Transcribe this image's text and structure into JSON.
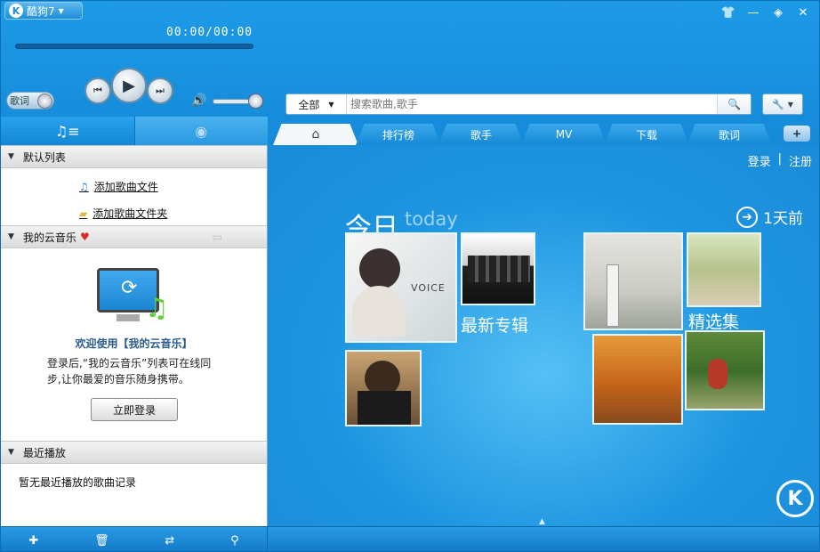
{
  "app": {
    "title": "酷狗7",
    "logo_letter": "K"
  },
  "player": {
    "time": "00:00/00:00",
    "lyric_toggle": "歌词"
  },
  "search": {
    "scope": "全部",
    "placeholder": "搜索歌曲,歌手"
  },
  "tabs": [
    {
      "label": "",
      "icon": "home-icon"
    },
    {
      "label": "排行榜"
    },
    {
      "label": "歌手"
    },
    {
      "label": "MV"
    },
    {
      "label": "下载"
    },
    {
      "label": "歌词"
    }
  ],
  "tab_add": "+",
  "sidebar": {
    "default_list": {
      "title": "默认列表",
      "add_file": "添加歌曲文件",
      "add_folder": "添加歌曲文件夹"
    },
    "cloud": {
      "title": "我的云音乐",
      "welcome_title": "欢迎使用【我的云音乐】",
      "welcome_desc": "登录后,“我的云音乐”列表可在线同步,让你最爱的音乐随身携带。",
      "login_button": "立即登录"
    },
    "recent": {
      "title": "最近播放",
      "empty": "暂无最近播放的歌曲记录"
    }
  },
  "main": {
    "login": "登录",
    "separator": "|",
    "register": "注册",
    "today": "今日",
    "today_en": "today",
    "prev_day": "1天前",
    "new_albums": "最新专辑",
    "featured": "精选集",
    "album_cover_text": "VOICE"
  },
  "colors": {
    "accent": "#1a8fd9",
    "panel": "#ffffff"
  }
}
